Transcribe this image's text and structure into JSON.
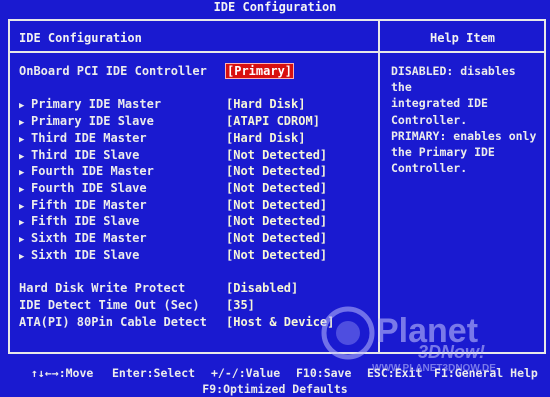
{
  "window_title": "IDE Configuration",
  "left_panel_title": "IDE Configuration",
  "right_panel_title": "Help Item",
  "onboard": {
    "label": "OnBoard PCI IDE Controller",
    "value": "[Primary]"
  },
  "drives": [
    {
      "label": "Primary IDE Master",
      "value": "[Hard Disk]"
    },
    {
      "label": "Primary IDE Slave",
      "value": "[ATAPI CDROM]"
    },
    {
      "label": "Third IDE Master",
      "value": "[Hard Disk]"
    },
    {
      "label": "Third IDE Slave",
      "value": "[Not Detected]"
    },
    {
      "label": "Fourth IDE Master",
      "value": "[Not Detected]"
    },
    {
      "label": "Fourth IDE Slave",
      "value": "[Not Detected]"
    },
    {
      "label": "Fifth IDE Master",
      "value": "[Not Detected]"
    },
    {
      "label": "Fifth IDE Slave",
      "value": "[Not Detected]"
    },
    {
      "label": "Sixth IDE Master",
      "value": "[Not Detected]"
    },
    {
      "label": "Sixth IDE Slave",
      "value": "[Not Detected]"
    }
  ],
  "settings": [
    {
      "label": "Hard Disk Write Protect",
      "value": "[Disabled]"
    },
    {
      "label": "IDE Detect Time Out (Sec)",
      "value": "[35]"
    },
    {
      "label": "ATA(PI) 80Pin Cable Detect",
      "value": "[Host & Device]"
    }
  ],
  "help_text": "DISABLED: disables the\nintegrated IDE\nController.\nPRIMARY: enables only\nthe Primary IDE\nController.",
  "footer": {
    "move": "↑↓←→:Move",
    "select": "Enter:Select",
    "value": "+/-/:Value",
    "save": "F10:Save",
    "exit": "ESC:Exit",
    "help": "F1:General Help",
    "optimized": "F9:Optimized Defaults"
  },
  "watermark": {
    "brand": "Planet",
    "sub": "3DNow!",
    "url": "WWW.PLANET3DNOW.DE"
  },
  "colors": {
    "background": "#1a1ad0",
    "highlight": "#d81010",
    "border": "#e8e8e8"
  }
}
